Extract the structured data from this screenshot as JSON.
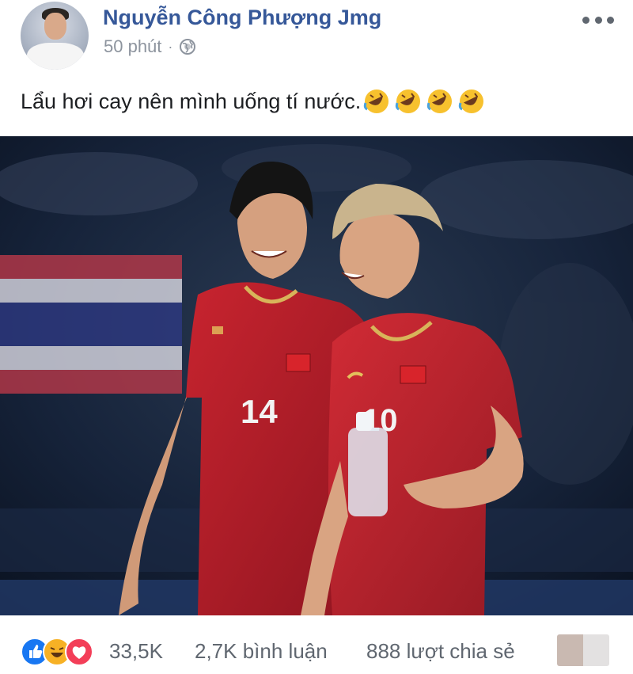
{
  "post": {
    "author_name": "Nguyễn Công Phượng Jmg",
    "timestamp": "50 phút",
    "separator": "·",
    "privacy_icon": "globe-icon",
    "more_icon": "more-dots-icon",
    "text": "Lẩu hơi cay nên mình uống tí nước.",
    "emoji": [
      "rolling-laugh-emoji",
      "rolling-laugh-emoji",
      "rolling-laugh-emoji",
      "rolling-laugh-emoji"
    ],
    "photo": {
      "jersey_numbers": [
        "14",
        "10"
      ],
      "jersey_color": "#b8202a"
    }
  },
  "footer": {
    "reactions": [
      "like-icon",
      "haha-icon",
      "love-icon"
    ],
    "reaction_count": "33,5K",
    "comments": "2,7K bình luận",
    "shares": "888 lượt chia sẻ"
  },
  "colors": {
    "author_blue": "#365899",
    "meta_gray": "#8d949e",
    "like_blue": "#1877f2",
    "love_red": "#f33e58",
    "haha_yellow": "#f7b125"
  }
}
